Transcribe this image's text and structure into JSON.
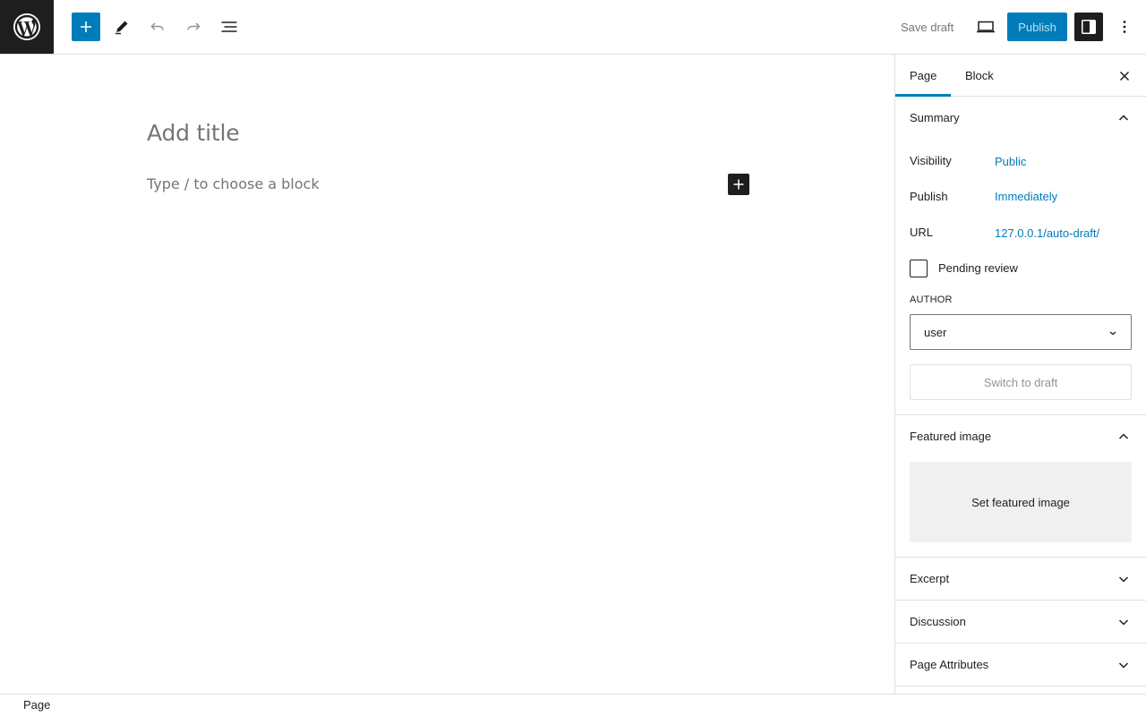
{
  "header": {
    "logo_icon": "wordpress-logo-icon",
    "inserter_icon": "plus-icon",
    "tools_icon": "pencil-icon",
    "undo_icon": "undo-icon",
    "redo_icon": "redo-icon",
    "list_view_icon": "list-view-icon",
    "save_draft_label": "Save draft",
    "preview_icon": "desktop-preview-icon",
    "publish_label": "Publish",
    "settings_icon": "sidebar-settings-icon",
    "options_icon": "more-vertical-icon"
  },
  "editor": {
    "title_placeholder": "Add title",
    "block_placeholder": "Type / to choose a block",
    "block_inserter_icon": "plus-icon"
  },
  "sidebar": {
    "tabs": [
      {
        "label": "Page",
        "active": true
      },
      {
        "label": "Block",
        "active": false
      }
    ],
    "close_icon": "close-icon",
    "summary": {
      "title": "Summary",
      "expanded": true,
      "rows": [
        {
          "label": "Visibility",
          "value": "Public"
        },
        {
          "label": "Publish",
          "value": "Immediately"
        },
        {
          "label": "URL",
          "value": "127.0.0.1/auto-draft/"
        }
      ],
      "pending_review_label": "Pending review",
      "pending_review_checked": false,
      "author_label": "AUTHOR",
      "author_value": "user",
      "switch_to_draft_label": "Switch to draft"
    },
    "featured_image": {
      "title": "Featured image",
      "expanded": true,
      "set_label": "Set featured image"
    },
    "collapsed_panels": [
      {
        "title": "Excerpt"
      },
      {
        "title": "Discussion"
      },
      {
        "title": "Page Attributes"
      }
    ]
  },
  "footer": {
    "breadcrumb": "Page"
  },
  "colors": {
    "accent": "#007cba",
    "dark": "#1e1e1e",
    "muted": "#757575",
    "border": "#e0e0e0"
  }
}
